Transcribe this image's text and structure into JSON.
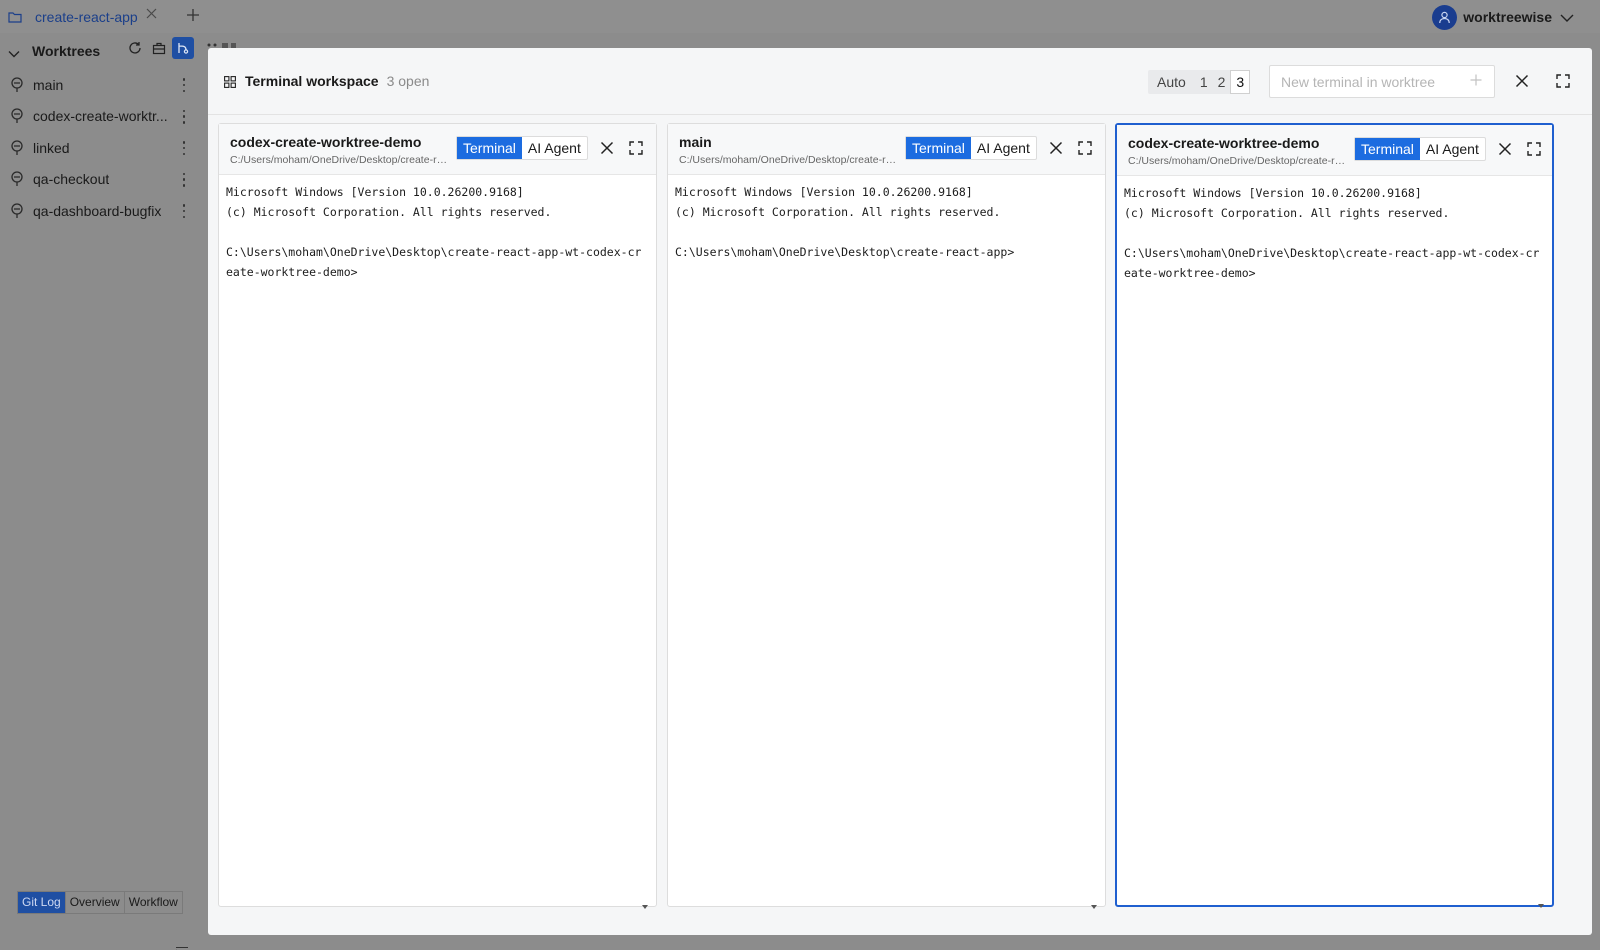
{
  "window": {
    "tab_label": "create-react-app",
    "user_name": "worktreewise"
  },
  "sidebar": {
    "title": "Worktrees",
    "items": [
      {
        "label": "main"
      },
      {
        "label": "codex-create-worktr..."
      },
      {
        "label": "linked"
      },
      {
        "label": "qa-checkout"
      },
      {
        "label": "qa-dashboard-bugfix"
      }
    ],
    "view_tabs": [
      {
        "label": "Git Log",
        "active": true
      },
      {
        "label": "Overview",
        "active": false
      },
      {
        "label": "Workflow",
        "active": false
      }
    ]
  },
  "modal": {
    "title": "Terminal workspace",
    "open_count": "3 open",
    "layout_options": [
      {
        "label": "Auto",
        "active": false
      },
      {
        "label": "1",
        "active": false
      },
      {
        "label": "2",
        "active": false
      },
      {
        "label": "3",
        "active": true
      }
    ],
    "new_terminal_placeholder": "New terminal in worktree",
    "accent_color": "#1c6ce0"
  },
  "panes": [
    {
      "name": "codex-create-worktree-demo",
      "path": "C:/Users/moham/OneDrive/Desktop/create-react-app-wt-codex-create-worktree-demo",
      "mode_terminal": "Terminal",
      "mode_agent": "AI Agent",
      "active_mode": "Terminal",
      "output": "Microsoft Windows [Version 10.0.26200.9168]\n(c) Microsoft Corporation. All rights reserved.\n\nC:\\Users\\moham\\OneDrive\\Desktop\\create-react-app-wt-codex-create-worktree-demo>"
    },
    {
      "name": "main",
      "path": "C:/Users/moham/OneDrive/Desktop/create-react-app",
      "mode_terminal": "Terminal",
      "mode_agent": "AI Agent",
      "active_mode": "Terminal",
      "output": "Microsoft Windows [Version 10.0.26200.9168]\n(c) Microsoft Corporation. All rights reserved.\n\nC:\\Users\\moham\\OneDrive\\Desktop\\create-react-app>"
    },
    {
      "name": "codex-create-worktree-demo",
      "path": "C:/Users/moham/OneDrive/Desktop/create-react-app-wt-codex-create-worktree-demo",
      "mode_terminal": "Terminal",
      "mode_agent": "AI Agent",
      "active_mode": "Terminal",
      "focused": true,
      "output": "Microsoft Windows [Version 10.0.26200.9168]\n(c) Microsoft Corporation. All rights reserved.\n\nC:\\Users\\moham\\OneDrive\\Desktop\\create-react-app-wt-codex-create-worktree-demo>"
    }
  ]
}
